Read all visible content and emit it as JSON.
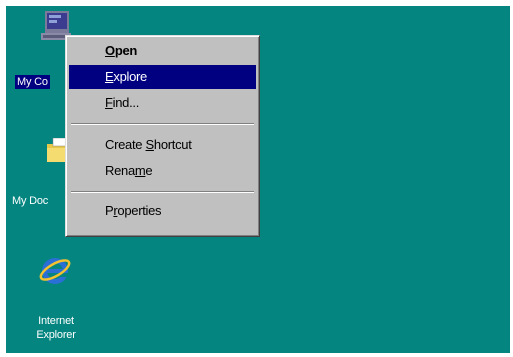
{
  "desktop": {
    "background_color": "#058580",
    "icons": [
      {
        "name": "my-computer",
        "label": "My Co",
        "icon": "computer-icon",
        "selected": true
      },
      {
        "name": "my-documents",
        "label": "My Doc",
        "icon": "folder-icon",
        "selected": false
      },
      {
        "name": "internet-explorer",
        "label_line1": "Internet",
        "label_line2": "Explorer",
        "icon": "internet-explorer-icon",
        "selected": false
      }
    ]
  },
  "context_menu": {
    "highlight_color": "#000080",
    "items": [
      {
        "pre": "",
        "key": "O",
        "post": "pen",
        "bold": true,
        "highlighted": false
      },
      {
        "pre": "",
        "key": "E",
        "post": "xplore",
        "bold": false,
        "highlighted": true
      },
      {
        "pre": "",
        "key": "F",
        "post": "ind...",
        "bold": false,
        "highlighted": false
      },
      {
        "pre": "Create ",
        "key": "S",
        "post": "hortcut",
        "bold": false,
        "highlighted": false
      },
      {
        "pre": "Rena",
        "key": "m",
        "post": "e",
        "bold": false,
        "highlighted": false
      },
      {
        "pre": "P",
        "key": "r",
        "post": "operties",
        "bold": false,
        "highlighted": false
      }
    ]
  }
}
